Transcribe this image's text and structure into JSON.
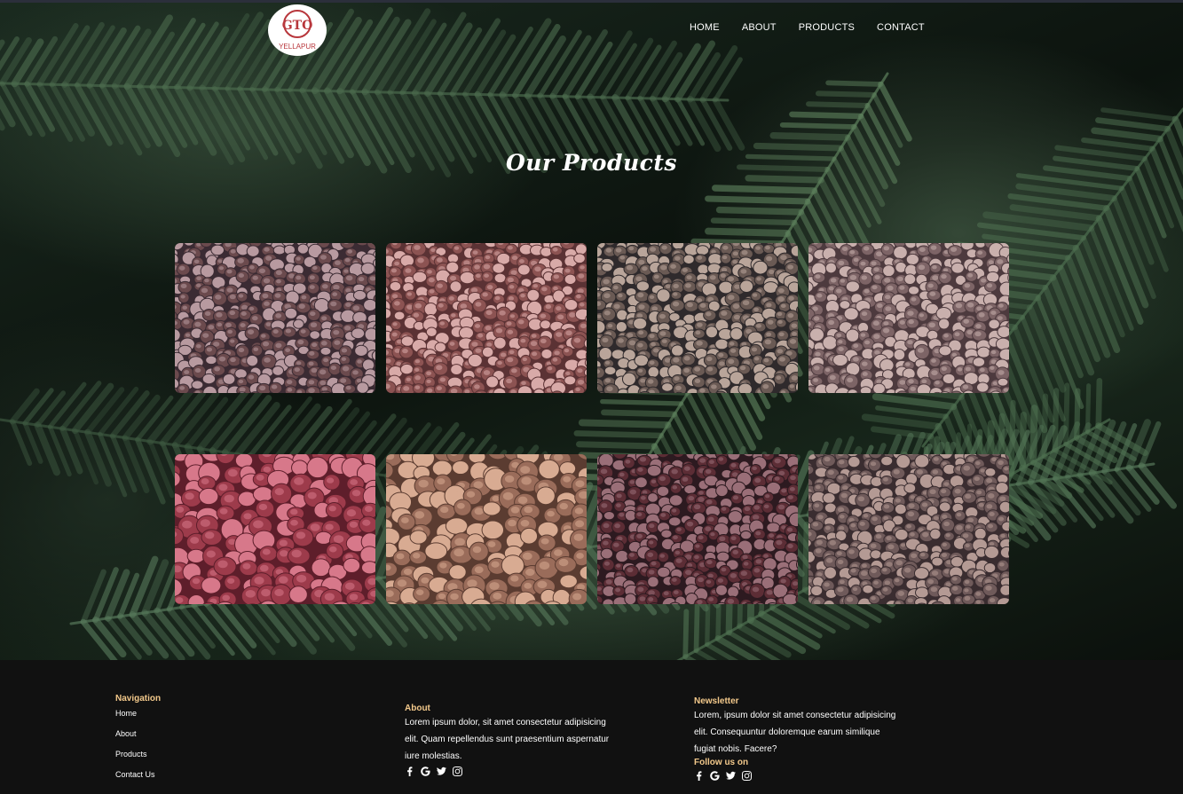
{
  "header": {
    "logo_text": "GTO",
    "logo_subtext": "YELLAPUR",
    "nav": [
      {
        "label": "HOME"
      },
      {
        "label": "ABOUT"
      },
      {
        "label": "PRODUCTS"
      },
      {
        "label": "CONTACT"
      }
    ]
  },
  "main": {
    "title": "Our Products",
    "products": [
      {
        "name": "product-1",
        "base": "#6b4a4d",
        "nut": "#b89aa0",
        "alt": "#3b2b33"
      },
      {
        "name": "product-2",
        "base": "#8c5352",
        "nut": "#d8aaa8",
        "alt": "#5b3234"
      },
      {
        "name": "product-3",
        "base": "#6a5a54",
        "nut": "#b9a59a",
        "alt": "#2f2a2c"
      },
      {
        "name": "product-4",
        "base": "#7d6466",
        "nut": "#c9b0ad",
        "alt": "#4d3a3e"
      },
      {
        "name": "product-5",
        "base": "#9d3b4b",
        "nut": "#d7788a",
        "alt": "#5e1e2b"
      },
      {
        "name": "product-6",
        "base": "#9a6c5a",
        "nut": "#d8ab92",
        "alt": "#5b3c31"
      },
      {
        "name": "product-7",
        "base": "#5c2d35",
        "nut": "#9a6f78",
        "alt": "#2d1a20"
      },
      {
        "name": "product-8",
        "base": "#6f5a5a",
        "nut": "#b49a94",
        "alt": "#3a2d30"
      }
    ]
  },
  "footer": {
    "navigation": {
      "heading": "Navigation",
      "links": [
        "Home",
        "About",
        "Products",
        "Contact Us"
      ]
    },
    "about": {
      "heading": "About",
      "text": "Lorem ipsum dolor, sit amet consectetur adipisicing elit. Quam repellendus sunt praesentium aspernatur iure molestias."
    },
    "newsletter": {
      "heading": "Newsletter",
      "text": "Lorem, ipsum dolor sit amet consectetur adipisicing elit. Consequuntur doloremque earum similique fugiat nobis. Facere?",
      "follow_label": "Follow us on"
    },
    "social_icons": [
      "facebook-icon",
      "google-icon",
      "twitter-icon",
      "instagram-icon"
    ]
  }
}
